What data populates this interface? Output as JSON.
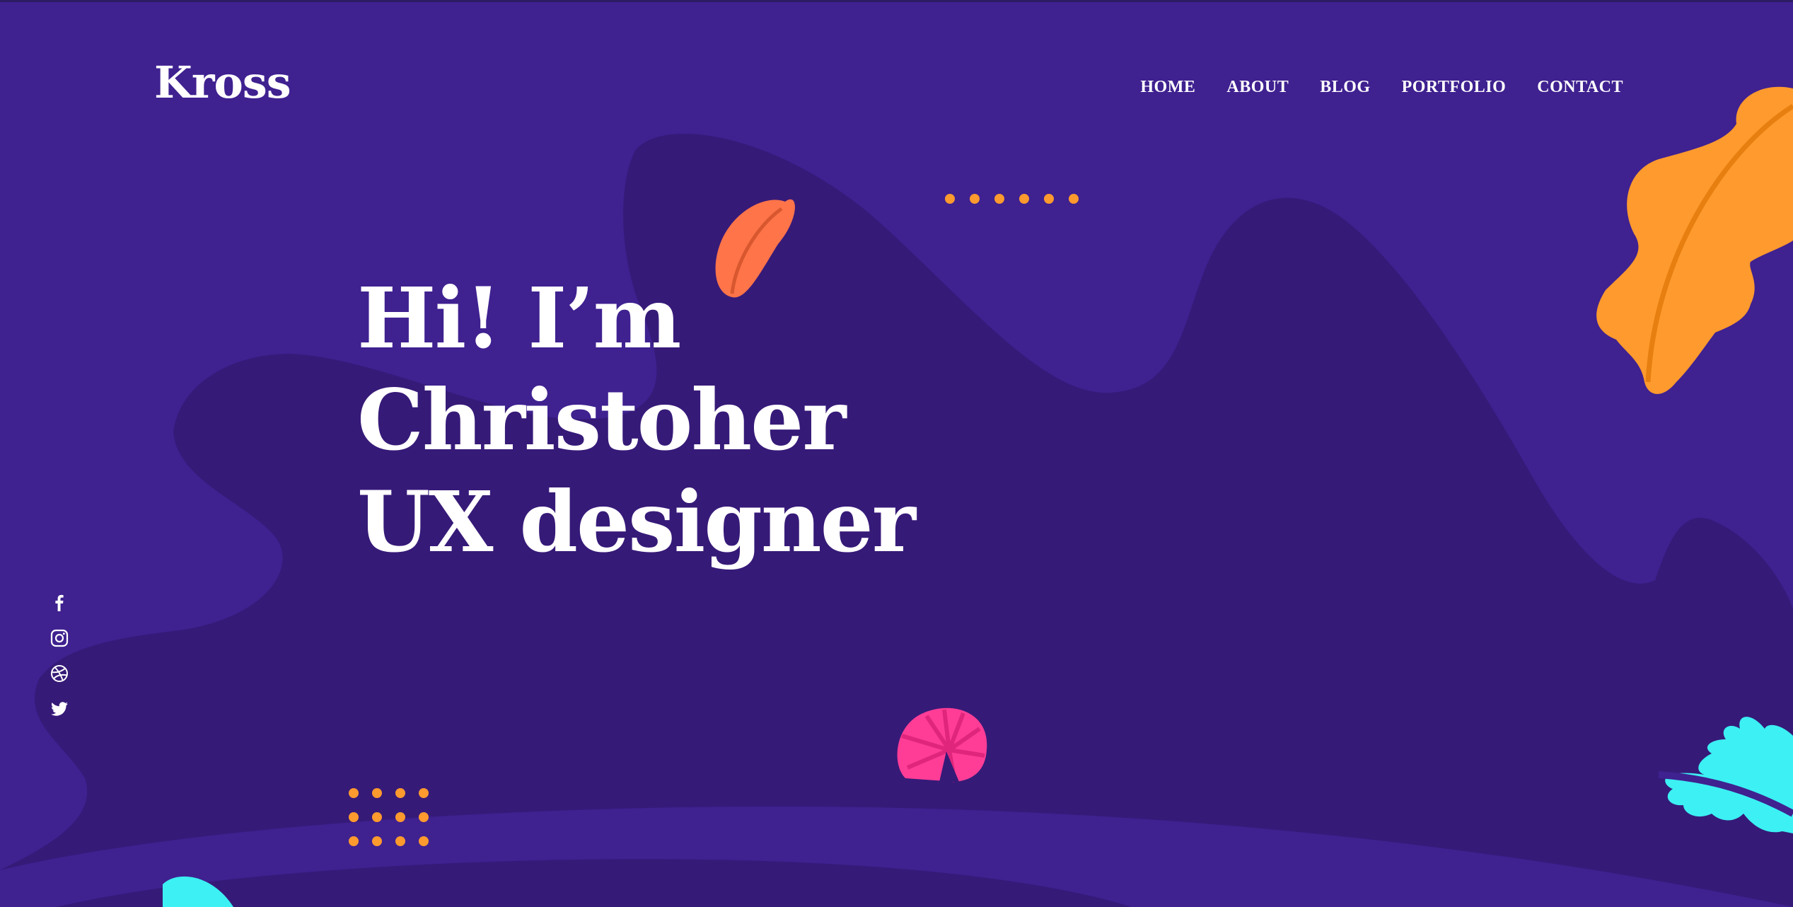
{
  "brand": {
    "logo": "Kross"
  },
  "nav": {
    "items": [
      {
        "label": "HOME"
      },
      {
        "label": "ABOUT"
      },
      {
        "label": "BLOG"
      },
      {
        "label": "PORTFOLIO"
      },
      {
        "label": "CONTACT"
      }
    ]
  },
  "hero": {
    "line1": "Hi! I’m",
    "line2": "Christoher",
    "line3": "UX designer"
  },
  "social": {
    "icons": [
      "facebook-icon",
      "instagram-icon",
      "dribbble-icon",
      "twitter-icon"
    ]
  },
  "colors": {
    "background": "#3f2190",
    "background_shape": "#361a78",
    "text": "#ffffff",
    "accent_orange": "#ff9a2e",
    "accent_coral": "#ff7449",
    "accent_pink": "#ff3d96",
    "accent_cyan": "#3cf0f3"
  }
}
